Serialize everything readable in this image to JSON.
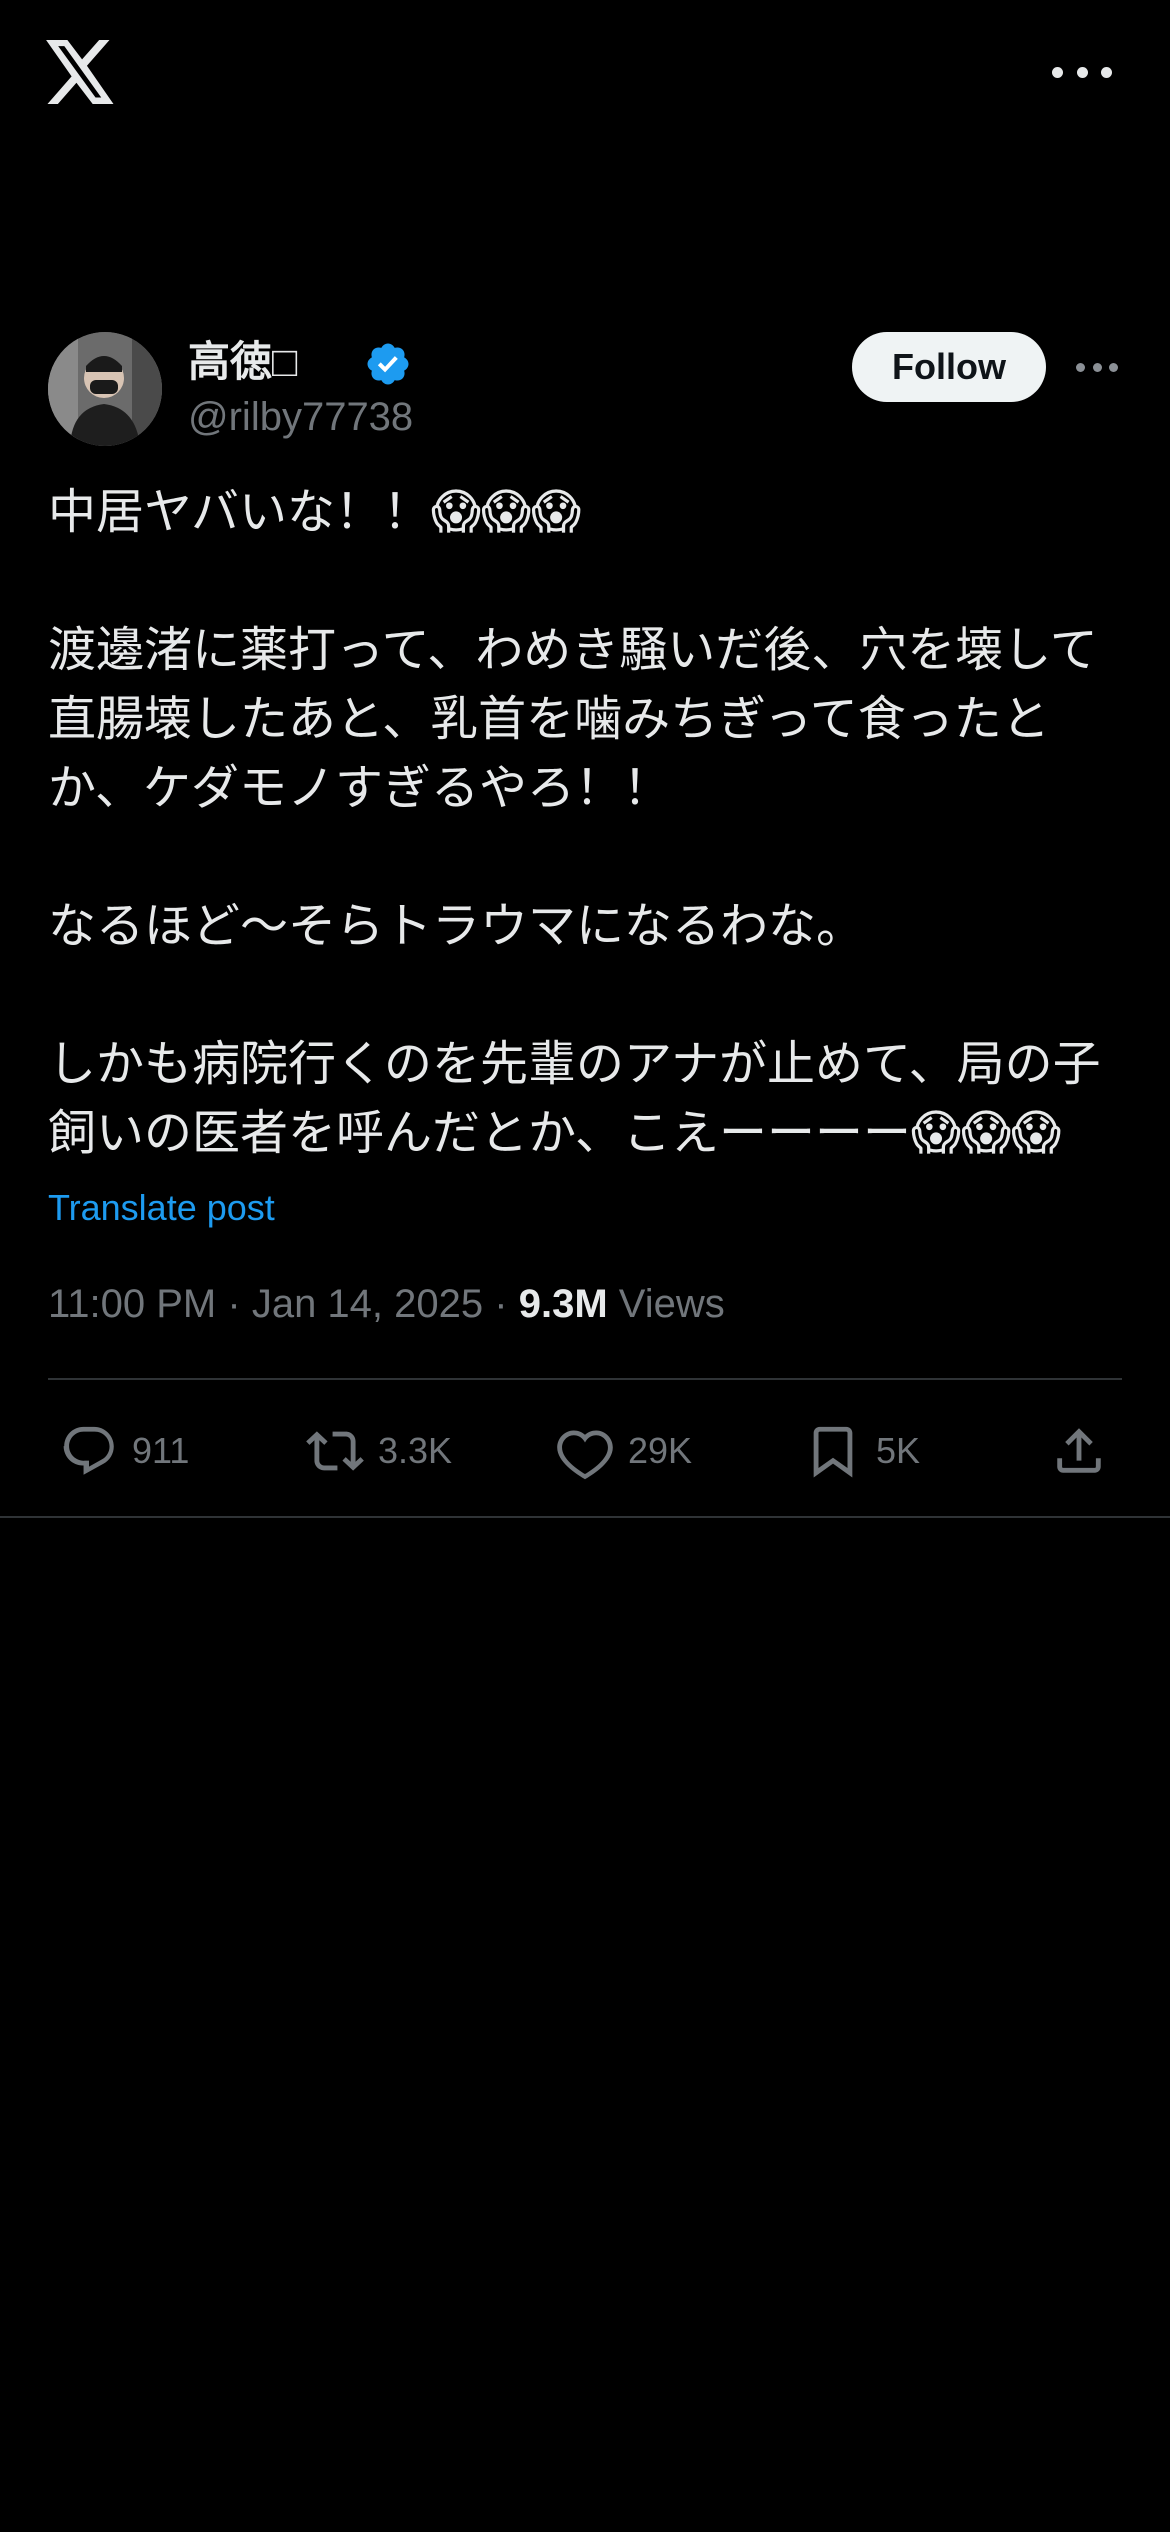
{
  "app": {
    "logo_icon": "x-logo-icon",
    "more_icon": "more-horizontal-icon"
  },
  "author": {
    "display_name": "高徳□",
    "handle": "@rilby77738",
    "verified": true,
    "verified_color": "#1d9bf0",
    "follow_label": "Follow"
  },
  "tweet": {
    "text": "中居ヤバいな！！😱😱😱\n\n渡邊渚に薬打って、わめき騒いだ後、穴を壊して直腸壊したあと、乳首を噛みちぎって食ったとか、ケダモノすぎるやろ！！\n\nなるほど〜そらトラウマになるわな。\n\nしかも病院行くのを先輩のアナが止めて、局の子飼いの医者を呼んだとか、こえーーーー😱😱😱",
    "translate_label": "Translate post",
    "time": "11:00 PM",
    "separator": "·",
    "date": "Jan 14, 2025",
    "views_count": "9.3M",
    "views_label": "Views"
  },
  "actions": {
    "reply": {
      "icon": "reply-icon",
      "count": "911"
    },
    "repost": {
      "icon": "repost-icon",
      "count": "3.3K"
    },
    "like": {
      "icon": "heart-icon",
      "count": "29K"
    },
    "bookmark": {
      "icon": "bookmark-icon",
      "count": "5K"
    },
    "share": {
      "icon": "share-icon"
    }
  },
  "colors": {
    "background": "#000000",
    "text_primary": "#e7e9ea",
    "text_secondary": "#71767b",
    "link": "#1d9bf0",
    "divider": "#2f3336"
  }
}
